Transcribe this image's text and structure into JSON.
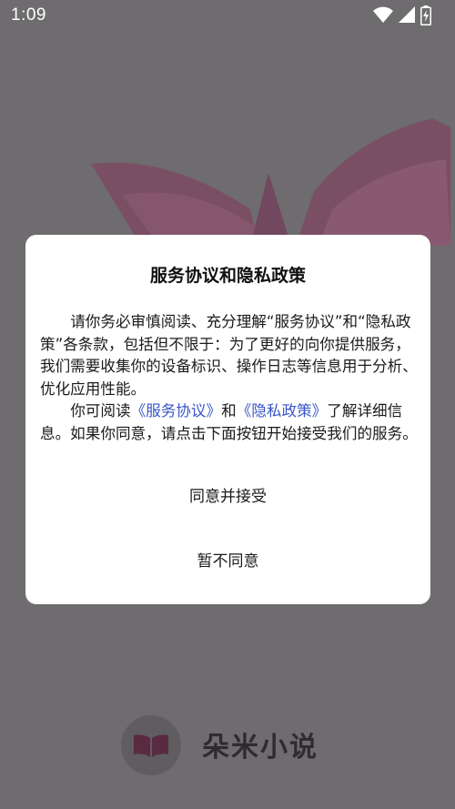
{
  "status_bar": {
    "time": "1:09",
    "icons": [
      "wifi-icon",
      "signal-icon",
      "battery-charging-icon"
    ]
  },
  "dialog": {
    "title": "服务协议和隐私政策",
    "paragraph1": "请你务必审慎阅读、充分理解“服务协议”和“隐私政策”各条款，包括但不限于：为了更好的向你提供服务，我们需要收集你的设备标识、操作日志等信息用于分析、优化应用性能。",
    "paragraph2_prefix": "你可阅读",
    "link_service": "《服务协议》",
    "paragraph2_mid": "和",
    "link_privacy": "《隐私政策》",
    "paragraph2_suffix": "了解详细信息。如果你同意，请点击下面按钮开始接受我们的服务。",
    "accept_label": "同意并接受",
    "decline_label": "暂不同意"
  },
  "brand": {
    "name": "朵米小说",
    "logo_icon": "open-book-icon"
  },
  "colors": {
    "overlay": "#6e6c6e",
    "link": "#3a55c8",
    "brand_accent": "#7a2e52"
  }
}
